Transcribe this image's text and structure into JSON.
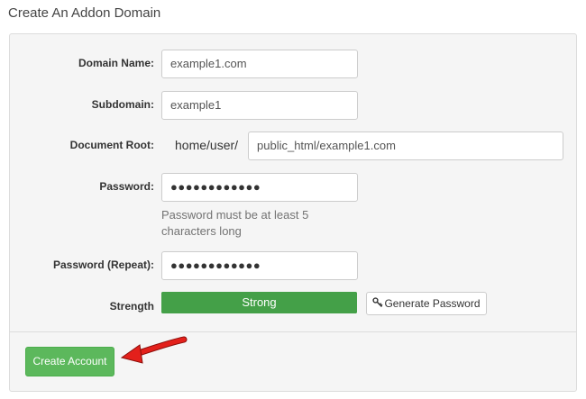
{
  "page": {
    "title": "Create An Addon Domain"
  },
  "form": {
    "domain_name": {
      "label": "Domain Name:",
      "value": "example1.com"
    },
    "subdomain": {
      "label": "Subdomain:",
      "value": "example1"
    },
    "document_root": {
      "label": "Document Root:",
      "prefix": "home/user/",
      "value": "public_html/example1.com"
    },
    "password": {
      "label": "Password:",
      "masked_value": "●●●●●●●●●●●●",
      "help_line1": "Password must be at least 5",
      "help_line2": "characters long"
    },
    "password_repeat": {
      "label": "Password (Repeat):",
      "masked_value": "●●●●●●●●●●●●"
    },
    "strength": {
      "label": "Strength",
      "text": "Strong",
      "level_fraction": 1.0,
      "color": "#44a048"
    },
    "generate_password_label": "Generate Password",
    "create_account_label": "Create Account"
  },
  "colors": {
    "primary_button": "#5cb85c",
    "annotation_arrow": "#e3201b"
  },
  "icons": {
    "generate": "key-icon",
    "annotation": "red-arrow-icon"
  }
}
